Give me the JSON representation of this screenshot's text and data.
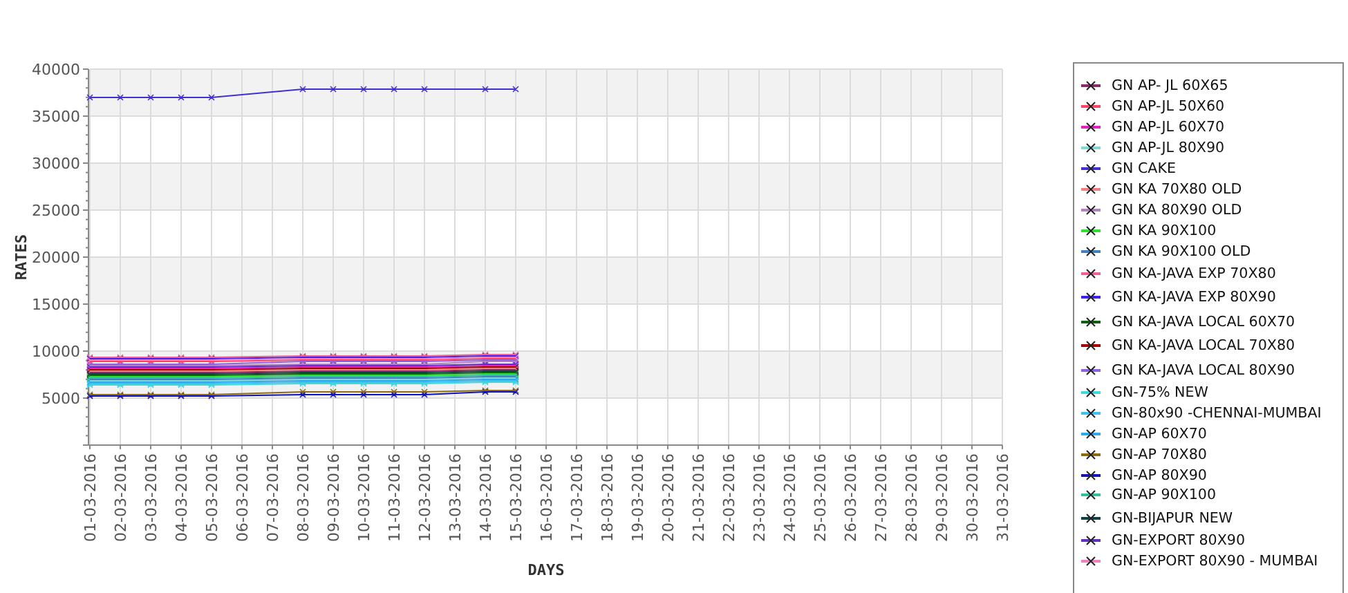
{
  "chart": {
    "chart_data": {
      "type": "line",
      "xlabel": "DAYS",
      "ylabel": "RATES",
      "grid": true,
      "categories": [
        "01-03-2016",
        "02-03-2016",
        "03-03-2016",
        "04-03-2016",
        "05-03-2016",
        "06-03-2016",
        "07-03-2016",
        "08-03-2016",
        "09-03-2016",
        "10-03-2016",
        "11-03-2016",
        "12-03-2016",
        "13-03-2016",
        "14-03-2016",
        "15-03-2016",
        "16-03-2016",
        "17-03-2016",
        "18-03-2016",
        "19-03-2016",
        "20-03-2016",
        "21-03-2016",
        "22-03-2016",
        "23-03-2016",
        "24-03-2016",
        "25-03-2016",
        "26-03-2016",
        "27-03-2016",
        "28-03-2016",
        "29-03-2016",
        "30-03-2016",
        "31-03-2016"
      ],
      "ylim": [
        0,
        40000
      ],
      "yticks": [
        5000,
        10000,
        15000,
        20000,
        25000,
        30000,
        35000,
        40000
      ],
      "series": [
        {
          "name": "GN AP- JL 60X65",
          "color": "#8b2a6b",
          "marker": "x",
          "values": [
            7850,
            7850,
            7850,
            7850,
            7850,
            null,
            null,
            8000,
            8000,
            8000,
            8000,
            8000,
            null,
            8150,
            8150,
            null,
            null,
            null,
            null,
            null,
            null,
            null,
            null,
            null,
            null,
            null,
            null,
            null,
            null,
            null,
            null
          ]
        },
        {
          "name": "GN AP-JL 50X60",
          "color": "#ff4466",
          "marker": "x",
          "values": [
            8900,
            8900,
            8900,
            8900,
            8900,
            null,
            null,
            9050,
            9050,
            9050,
            9050,
            9050,
            null,
            9200,
            9200,
            null,
            null,
            null,
            null,
            null,
            null,
            null,
            null,
            null,
            null,
            null,
            null,
            null,
            null,
            null,
            null
          ]
        },
        {
          "name": "GN AP-JL 60X70",
          "color": "#e020c0",
          "marker": "x",
          "values": [
            8300,
            8300,
            8300,
            8300,
            8300,
            null,
            null,
            8450,
            8450,
            8450,
            8450,
            8450,
            null,
            8600,
            8600,
            null,
            null,
            null,
            null,
            null,
            null,
            null,
            null,
            null,
            null,
            null,
            null,
            null,
            null,
            null,
            null
          ]
        },
        {
          "name": "GN AP-JL 80X90",
          "color": "#80d8d0",
          "marker": "x",
          "values": [
            6950,
            6950,
            6950,
            6950,
            6950,
            null,
            null,
            7100,
            7100,
            7100,
            7100,
            7100,
            null,
            7250,
            7250,
            null,
            null,
            null,
            null,
            null,
            null,
            null,
            null,
            null,
            null,
            null,
            null,
            null,
            null,
            null,
            null
          ]
        },
        {
          "name": "GN CAKE",
          "color": "#4030d0",
          "marker": "x",
          "values": [
            37000,
            37000,
            37000,
            37000,
            37000,
            null,
            null,
            38000,
            38000,
            38000,
            38000,
            38000,
            null,
            38000,
            38000,
            null,
            null,
            null,
            null,
            null,
            null,
            null,
            null,
            null,
            null,
            null,
            null,
            null,
            null,
            null,
            null
          ]
        },
        {
          "name": "GN KA 70X80 OLD",
          "color": "#f08080",
          "marker": "x",
          "values": [
            8000,
            8000,
            8000,
            8000,
            8000,
            null,
            null,
            8150,
            8150,
            8150,
            8150,
            8150,
            null,
            8300,
            8300,
            null,
            null,
            null,
            null,
            null,
            null,
            null,
            null,
            null,
            null,
            null,
            null,
            null,
            null,
            null,
            null
          ]
        },
        {
          "name": "GN KA 80X90 OLD",
          "color": "#b080c0",
          "marker": "x",
          "values": [
            8600,
            8600,
            8600,
            8600,
            8600,
            null,
            null,
            8750,
            8750,
            8750,
            8750,
            8750,
            null,
            8900,
            8900,
            null,
            null,
            null,
            null,
            null,
            null,
            null,
            null,
            null,
            null,
            null,
            null,
            null,
            null,
            null,
            null
          ]
        },
        {
          "name": "GN KA 90X100",
          "color": "#30e030",
          "marker": "x",
          "values": [
            7400,
            7400,
            7400,
            7400,
            7400,
            null,
            null,
            7550,
            7550,
            7550,
            7550,
            7550,
            null,
            7700,
            7700,
            null,
            null,
            null,
            null,
            null,
            null,
            null,
            null,
            null,
            null,
            null,
            null,
            null,
            null,
            null,
            null
          ]
        },
        {
          "name": "GN KA 90X100 OLD",
          "color": "#4080c0",
          "marker": "x",
          "values": [
            7100,
            7100,
            7100,
            7100,
            7100,
            null,
            null,
            7250,
            7250,
            7250,
            7250,
            7250,
            null,
            7400,
            7400,
            null,
            null,
            null,
            null,
            null,
            null,
            null,
            null,
            null,
            null,
            null,
            null,
            null,
            null,
            null,
            null
          ]
        },
        {
          "name": "GN KA-JAVA EXP 70X80",
          "color": "#f06090",
          "marker": "x",
          "values": [
            9350,
            9350,
            9350,
            9350,
            9350,
            null,
            null,
            9500,
            9500,
            9500,
            9500,
            9500,
            null,
            9650,
            9650,
            null,
            null,
            null,
            null,
            null,
            null,
            null,
            null,
            null,
            null,
            null,
            null,
            null,
            null,
            null,
            null
          ]
        },
        {
          "name": "GN KA-JAVA EXP 80X90",
          "color": "#4020f0",
          "marker": "x",
          "values": [
            9200,
            9200,
            9200,
            9200,
            9200,
            null,
            null,
            9350,
            9350,
            9350,
            9350,
            9350,
            null,
            9500,
            9500,
            null,
            null,
            null,
            null,
            null,
            null,
            null,
            null,
            null,
            null,
            null,
            null,
            null,
            null,
            null,
            null
          ]
        },
        {
          "name": "GN KA-JAVA LOCAL 60X70",
          "color": "#106010",
          "marker": "x",
          "values": [
            7550,
            7550,
            7550,
            7550,
            7550,
            null,
            null,
            7700,
            7700,
            7700,
            7700,
            7700,
            null,
            7850,
            7850,
            null,
            null,
            null,
            null,
            null,
            null,
            null,
            null,
            null,
            null,
            null,
            null,
            null,
            null,
            null,
            null
          ]
        },
        {
          "name": "GN KA-JAVA LOCAL 70X80",
          "color": "#a00000",
          "marker": "x",
          "values": [
            8150,
            8150,
            8150,
            8150,
            8150,
            null,
            null,
            8300,
            8300,
            8300,
            8300,
            8300,
            null,
            8450,
            8450,
            null,
            null,
            null,
            null,
            null,
            null,
            null,
            null,
            null,
            null,
            null,
            null,
            null,
            null,
            null,
            null
          ]
        },
        {
          "name": "GN KA-JAVA LOCAL 80X90",
          "color": "#9060e0",
          "marker": "x",
          "values": [
            8750,
            8750,
            8750,
            8750,
            8750,
            null,
            null,
            8900,
            8900,
            8900,
            8900,
            8900,
            null,
            9050,
            9050,
            null,
            null,
            null,
            null,
            null,
            null,
            null,
            null,
            null,
            null,
            null,
            null,
            null,
            null,
            null,
            null
          ]
        },
        {
          "name": "GN-75% NEW",
          "color": "#40d8d8",
          "marker": "x",
          "values": [
            6500,
            6500,
            6500,
            6500,
            6500,
            null,
            null,
            6650,
            6650,
            6650,
            6650,
            6650,
            null,
            6800,
            6800,
            null,
            null,
            null,
            null,
            null,
            null,
            null,
            null,
            null,
            null,
            null,
            null,
            null,
            null,
            null,
            null
          ]
        },
        {
          "name": "GN-80x90 -CHENNAI-MUMBAI",
          "color": "#40c0f0",
          "marker": "x",
          "values": [
            6650,
            6650,
            6650,
            6650,
            6650,
            null,
            null,
            6800,
            6800,
            6800,
            6800,
            6800,
            null,
            6950,
            6950,
            null,
            null,
            null,
            null,
            null,
            null,
            null,
            null,
            null,
            null,
            null,
            null,
            null,
            null,
            null,
            null
          ]
        },
        {
          "name": "GN-AP 60X70",
          "color": "#30a8f0",
          "marker": "x",
          "values": [
            6800,
            6800,
            6800,
            6800,
            6800,
            null,
            null,
            6950,
            6950,
            6950,
            6950,
            6950,
            null,
            7100,
            7100,
            null,
            null,
            null,
            null,
            null,
            null,
            null,
            null,
            null,
            null,
            null,
            null,
            null,
            null,
            null,
            null
          ]
        },
        {
          "name": "GN-AP 70X80",
          "color": "#8b6a10",
          "marker": "x",
          "values": [
            5500,
            5500,
            5500,
            5500,
            5500,
            null,
            null,
            5700,
            5700,
            5700,
            5700,
            5700,
            null,
            5900,
            5900,
            null,
            null,
            null,
            null,
            null,
            null,
            null,
            null,
            null,
            null,
            null,
            null,
            null,
            null,
            null,
            null
          ]
        },
        {
          "name": "GN-AP 80X90",
          "color": "#1010c0",
          "marker": "x",
          "values": [
            5300,
            5300,
            5300,
            5300,
            5300,
            null,
            null,
            5500,
            5500,
            5500,
            5500,
            5500,
            null,
            5700,
            5700,
            null,
            null,
            null,
            null,
            null,
            null,
            null,
            null,
            null,
            null,
            null,
            null,
            null,
            null,
            null,
            null
          ]
        },
        {
          "name": "GN-AP 90X100",
          "color": "#30c0a0",
          "marker": "x",
          "values": [
            7250,
            7250,
            7250,
            7250,
            7250,
            null,
            null,
            7400,
            7400,
            7400,
            7400,
            7400,
            null,
            7550,
            7550,
            null,
            null,
            null,
            null,
            null,
            null,
            null,
            null,
            null,
            null,
            null,
            null,
            null,
            null,
            null,
            null
          ]
        },
        {
          "name": "GN-BIJAPUR NEW",
          "color": "#104040",
          "marker": "x",
          "values": [
            7700,
            7700,
            7700,
            7700,
            7700,
            null,
            null,
            7850,
            7850,
            7850,
            7850,
            7850,
            null,
            8000,
            8000,
            null,
            null,
            null,
            null,
            null,
            null,
            null,
            null,
            null,
            null,
            null,
            null,
            null,
            null,
            null,
            null
          ]
        },
        {
          "name": "GN-EXPORT 80X90",
          "color": "#6030c0",
          "marker": "x",
          "values": [
            8450,
            8450,
            8450,
            8450,
            8450,
            null,
            null,
            8600,
            8600,
            8600,
            8600,
            8600,
            null,
            8750,
            8750,
            null,
            null,
            null,
            null,
            null,
            null,
            null,
            null,
            null,
            null,
            null,
            null,
            null,
            null,
            null,
            null
          ]
        },
        {
          "name": "GN-EXPORT 80X90 - MUMBAI",
          "color": "#f080c0",
          "marker": "x",
          "values": [
            9050,
            9050,
            9050,
            9050,
            9050,
            null,
            null,
            9200,
            9200,
            9200,
            9200,
            9200,
            null,
            9350,
            9350,
            null,
            null,
            null,
            null,
            null,
            null,
            null,
            null,
            null,
            null,
            null,
            null,
            null,
            null,
            null,
            null
          ]
        }
      ]
    }
  }
}
